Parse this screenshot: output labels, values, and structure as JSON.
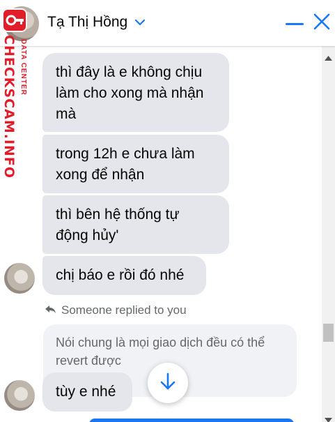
{
  "header": {
    "title": "Tạ Thị Hồng",
    "icons": {
      "dropdown": "chevron-down-icon",
      "minimize": "minimize-icon",
      "close": "close-icon"
    },
    "accent_color": "#1877f2"
  },
  "watermark": {
    "line1": "CHECKSCAM.INFO",
    "line2": "DATA CENTER",
    "color": "#e11d2a"
  },
  "messages": [
    {
      "text": "thì đây là e không chịu làm cho xong mà nhận mà"
    },
    {
      "text": "trong 12h e chưa làm xong để nhận"
    },
    {
      "text": "thì bên hệ thống tự động hủy'"
    },
    {
      "text": "chị báo e rồi đó nhé"
    },
    {
      "text": "tùy e nhé"
    }
  ],
  "reply": {
    "note": "Someone replied to you",
    "quoted_text": "Nói chung là mọi giao dịch đều có thể revert được"
  },
  "controls": {
    "scroll_down_icon": "arrow-down-icon"
  },
  "colors": {
    "bubble_bg": "#e4e6eb",
    "quote_bg": "#f0f2f5",
    "muted_text": "#65676b"
  }
}
